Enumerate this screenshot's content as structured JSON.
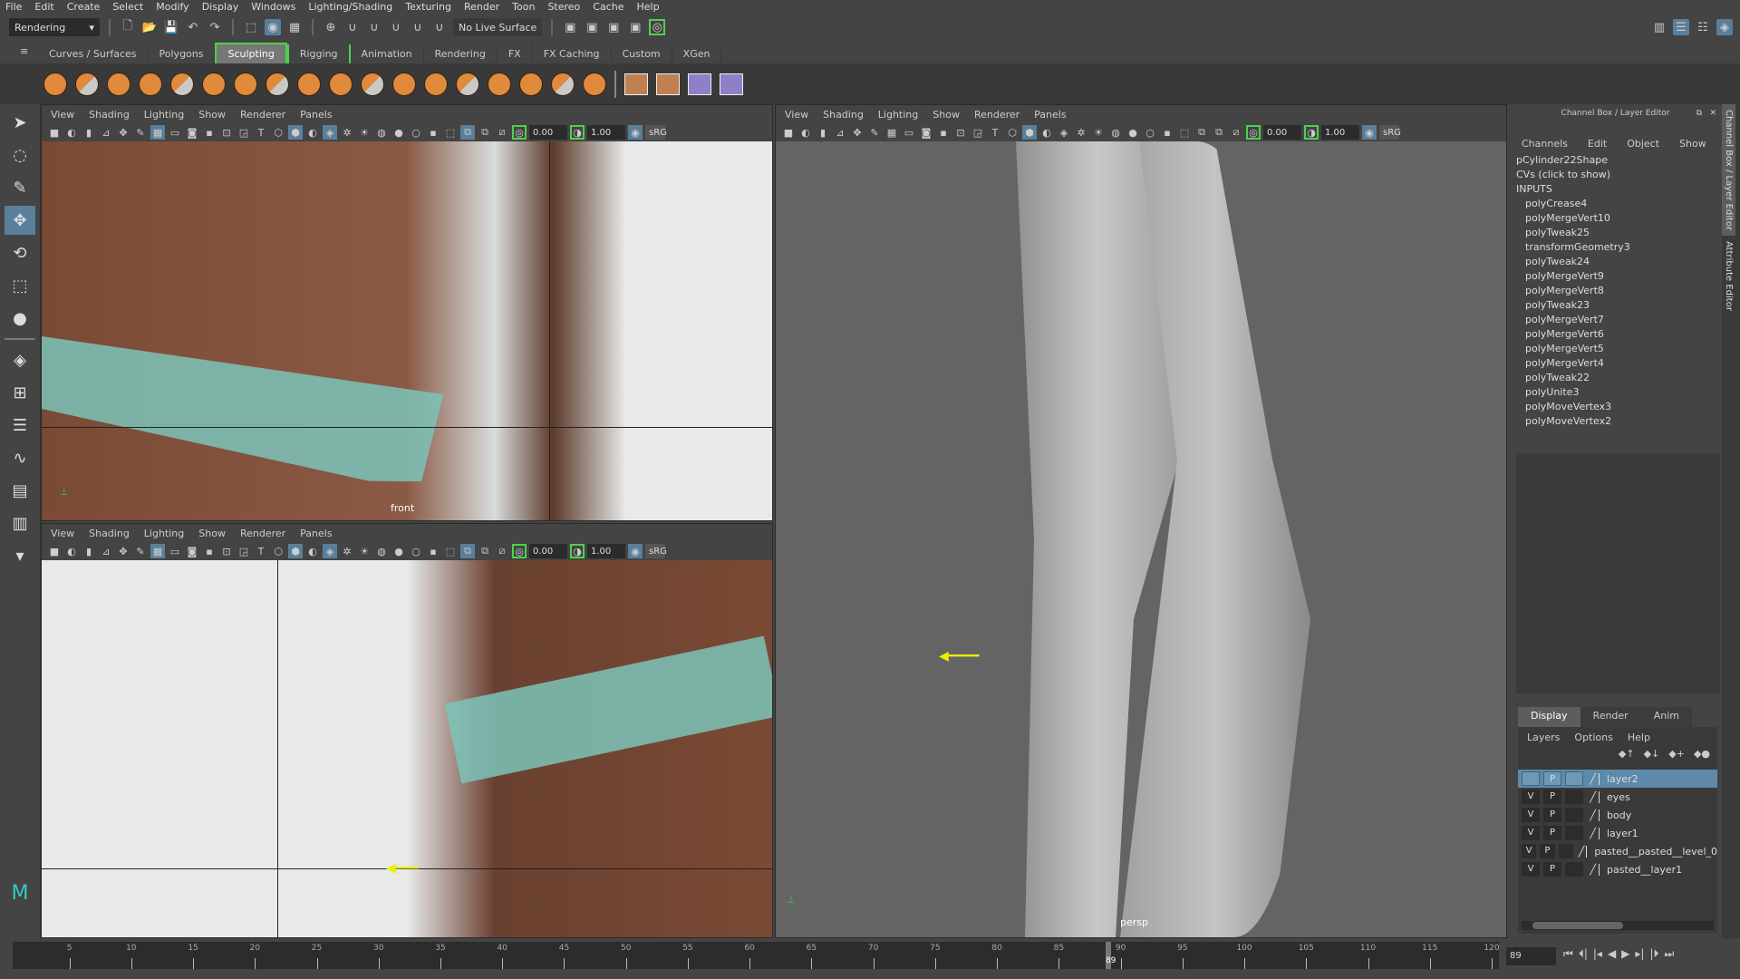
{
  "menubar": [
    "File",
    "Edit",
    "Create",
    "Select",
    "Modify",
    "Display",
    "Windows",
    "Lighting/Shading",
    "Texturing",
    "Render",
    "Toon",
    "Stereo",
    "Cache",
    "Help"
  ],
  "statusline": {
    "menuset": "Rendering",
    "live_surface": "No Live Surface"
  },
  "shelf_tabs": [
    {
      "label": "Curves / Surfaces",
      "state": ""
    },
    {
      "label": "Polygons",
      "state": ""
    },
    {
      "label": "Sculpting",
      "state": "active"
    },
    {
      "label": "Rigging",
      "state": "bracket"
    },
    {
      "label": "Animation",
      "state": ""
    },
    {
      "label": "Rendering",
      "state": ""
    },
    {
      "label": "FX",
      "state": ""
    },
    {
      "label": "FX Caching",
      "state": ""
    },
    {
      "label": "Custom",
      "state": ""
    },
    {
      "label": "XGen",
      "state": ""
    }
  ],
  "shelf_icons": [
    "sculpt-tool",
    "smooth-tool",
    "relax-tool",
    "grab-tool",
    "pinch-tool",
    "flatten-tool",
    "foamy-tool",
    "spray-tool",
    "repeat-tool",
    "imprint-tool",
    "wax-tool",
    "scrape-tool",
    "fill-tool",
    "knife-tool",
    "smear-tool",
    "bulge-tool",
    "amplify-tool",
    "freeze-tool"
  ],
  "shelf_misc_icons": [
    "freeze-icon",
    "hypershade-icon",
    "render-view-icon",
    "render-settings-icon"
  ],
  "panel_menu": [
    "View",
    "Shading",
    "Lighting",
    "Show",
    "Renderer",
    "Panels"
  ],
  "panel_toolbar": {
    "exposure": "0.00",
    "gamma": "1.00",
    "colorspace": "sRG"
  },
  "viewports": {
    "top_left_label": "front",
    "right_label": "persp"
  },
  "channel_box": {
    "title": "Channel Box / Layer Editor",
    "menu": [
      "Channels",
      "Edit",
      "Object",
      "Show"
    ],
    "shape": "pCylinder22Shape",
    "cvs": "CVs (click to show)",
    "inputs_header": "INPUTS",
    "inputs": [
      "polyCrease4",
      "polyMergeVert10",
      "polyTweak25",
      "transformGeometry3",
      "polyTweak24",
      "polyMergeVert9",
      "polyMergeVert8",
      "polyTweak23",
      "polyMergeVert7",
      "polyMergeVert6",
      "polyMergeVert5",
      "polyMergeVert4",
      "polyTweak22",
      "polyUnite3",
      "polyMoveVertex3",
      "polyMoveVertex2"
    ]
  },
  "layer_editor": {
    "tabs": [
      {
        "label": "Display",
        "active": true
      },
      {
        "label": "Render",
        "active": false
      },
      {
        "label": "Anim",
        "active": false
      }
    ],
    "menu": [
      "Layers",
      "Options",
      "Help"
    ],
    "layers": [
      {
        "v": "",
        "p": "P",
        "name": "layer2",
        "selected": true
      },
      {
        "v": "V",
        "p": "P",
        "name": "eyes",
        "selected": false
      },
      {
        "v": "V",
        "p": "P",
        "name": "body",
        "selected": false
      },
      {
        "v": "V",
        "p": "P",
        "name": "layer1",
        "selected": false
      },
      {
        "v": "V",
        "p": "P",
        "name": "pasted__pasted__level_0",
        "selected": false
      },
      {
        "v": "V",
        "p": "P",
        "name": "pasted__layer1",
        "selected": false
      }
    ]
  },
  "side_tabs": [
    "Channel Box / Layer Editor",
    "Attribute Editor"
  ],
  "timeslider": {
    "start": 1,
    "end": 120,
    "labels": [
      5,
      10,
      15,
      20,
      25,
      30,
      35,
      40,
      45,
      50,
      55,
      60,
      65,
      70,
      75,
      80,
      85,
      90,
      95,
      100,
      105,
      110,
      115,
      120
    ],
    "current_frame": 89,
    "current_frame_field": "89"
  }
}
